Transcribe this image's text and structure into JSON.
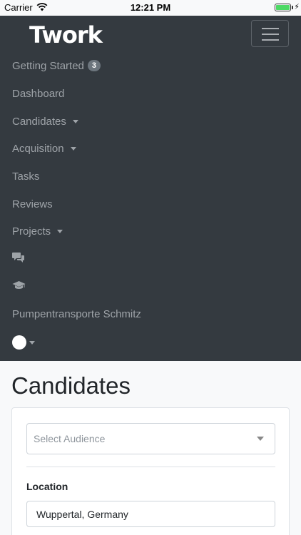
{
  "status_bar": {
    "carrier": "Carrier",
    "time": "12:21 PM"
  },
  "navbar": {
    "brand": "Twork",
    "items": [
      {
        "label": "Getting Started",
        "badge": "3"
      },
      {
        "label": "Dashboard"
      },
      {
        "label": "Candidates",
        "dropdown": true
      },
      {
        "label": "Acquisition",
        "dropdown": true
      },
      {
        "label": "Tasks"
      },
      {
        "label": "Reviews"
      },
      {
        "label": "Projects",
        "dropdown": true
      },
      {
        "icon": "comments-icon"
      },
      {
        "icon": "graduation-cap-icon"
      },
      {
        "label": "Pumpentransporte Schmitz"
      },
      {
        "icon": "avatar",
        "dropdown": true
      }
    ]
  },
  "main": {
    "title": "Candidates",
    "audience_select": {
      "placeholder": "Select Audience"
    },
    "location": {
      "label": "Location",
      "value": "Wuppertal, Germany"
    }
  }
}
